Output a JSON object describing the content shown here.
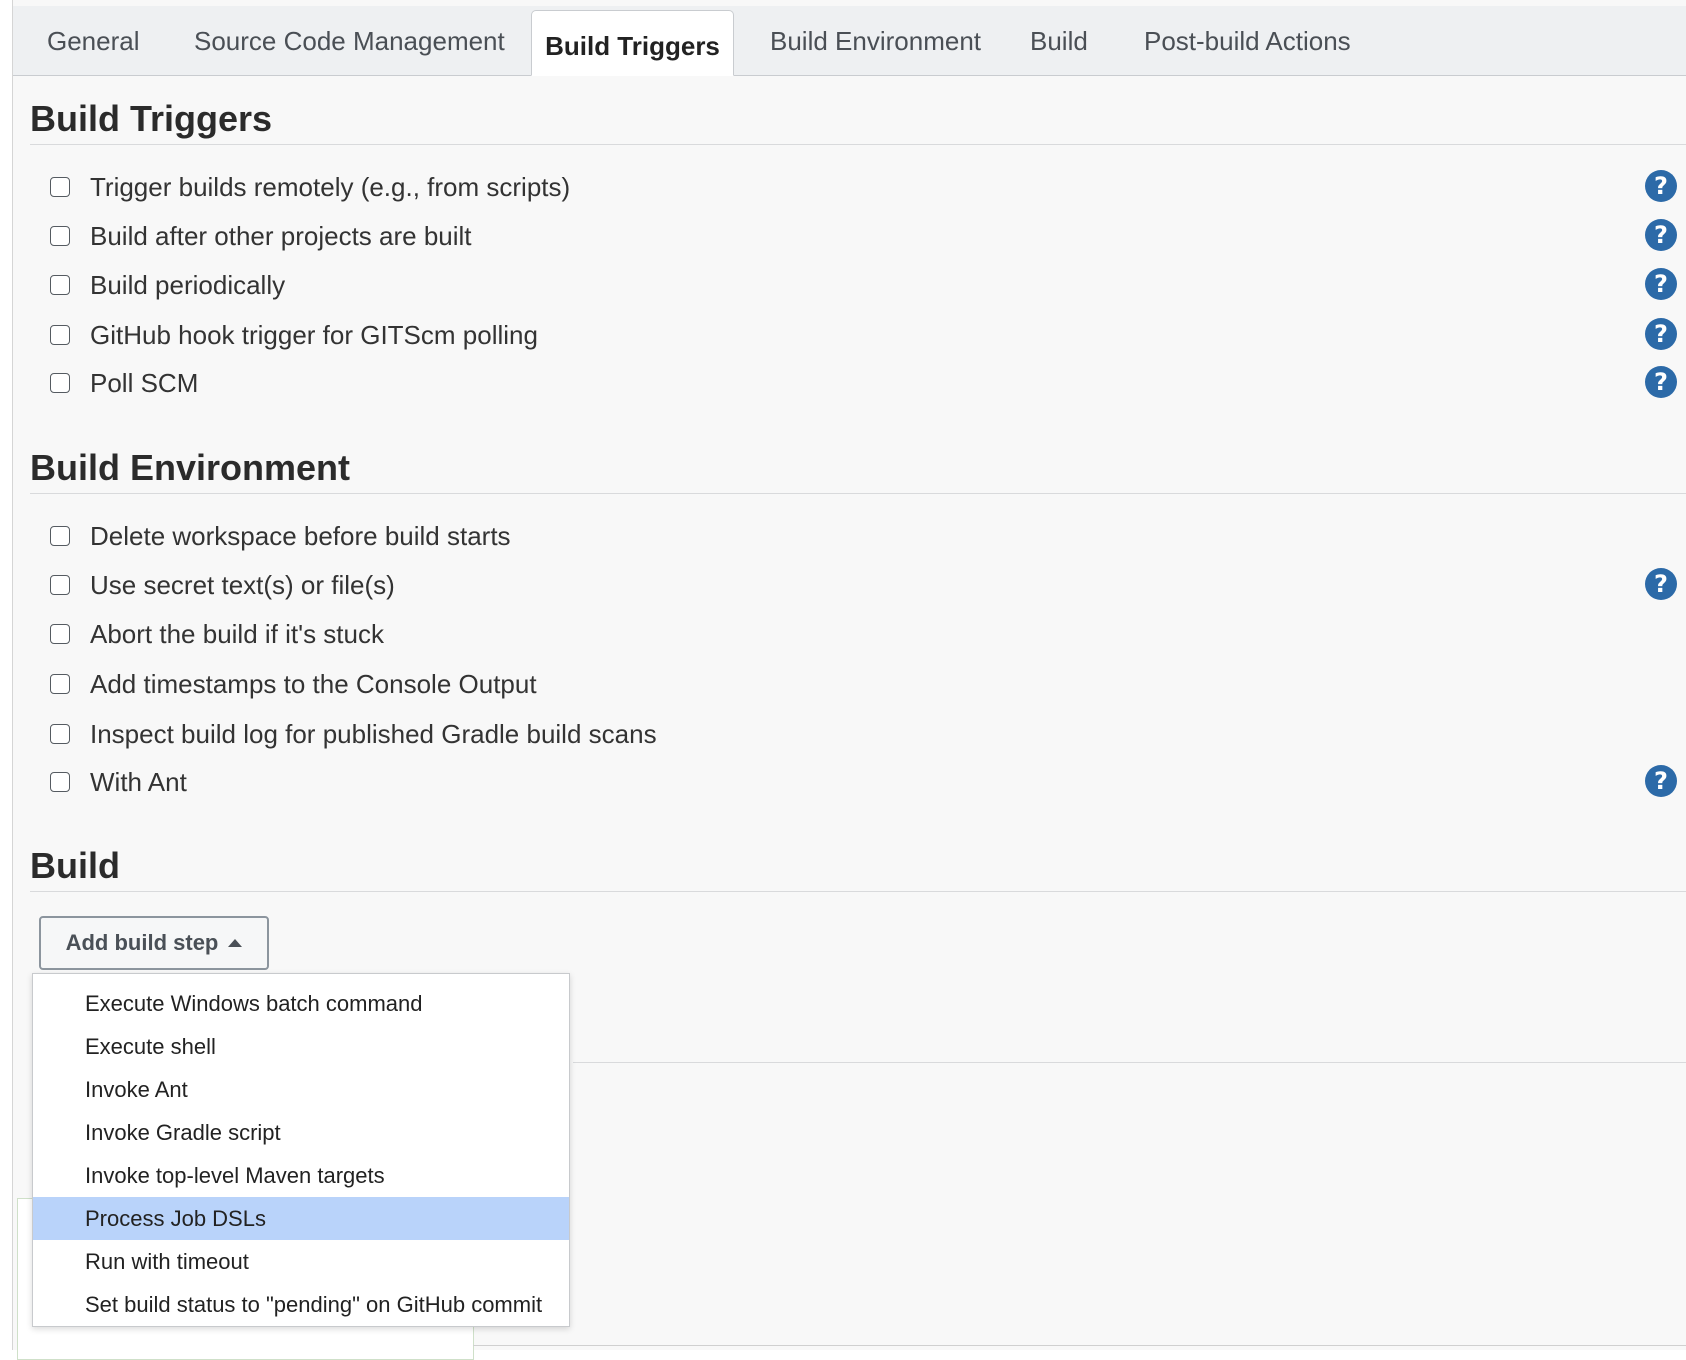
{
  "tabs": [
    {
      "label": "General"
    },
    {
      "label": "Source Code Management"
    },
    {
      "label": "Build Triggers"
    },
    {
      "label": "Build Environment"
    },
    {
      "label": "Build"
    },
    {
      "label": "Post-build Actions"
    }
  ],
  "active_tab": "Build Triggers",
  "build_triggers": {
    "title": "Build Triggers",
    "options": [
      {
        "label": "Trigger builds remotely (e.g., from scripts)",
        "checked": false,
        "help": true
      },
      {
        "label": "Build after other projects are built",
        "checked": false,
        "help": true
      },
      {
        "label": "Build periodically",
        "checked": false,
        "help": true
      },
      {
        "label": "GitHub hook trigger for GITScm polling",
        "checked": false,
        "help": true
      },
      {
        "label": "Poll SCM",
        "checked": false,
        "help": true
      }
    ]
  },
  "build_environment": {
    "title": "Build Environment",
    "options": [
      {
        "label": "Delete workspace before build starts",
        "checked": false,
        "help": false
      },
      {
        "label": "Use secret text(s) or file(s)",
        "checked": false,
        "help": true
      },
      {
        "label": "Abort the build if it's stuck",
        "checked": false,
        "help": false
      },
      {
        "label": "Add timestamps to the Console Output",
        "checked": false,
        "help": false
      },
      {
        "label": "Inspect build log for published Gradle build scans",
        "checked": false,
        "help": false
      },
      {
        "label": "With Ant",
        "checked": false,
        "help": true
      }
    ]
  },
  "build": {
    "title": "Build",
    "add_step_label": "Add build step",
    "menu": {
      "items": [
        {
          "label": "Execute Windows batch command"
        },
        {
          "label": "Execute shell"
        },
        {
          "label": "Invoke Ant"
        },
        {
          "label": "Invoke Gradle script"
        },
        {
          "label": "Invoke top-level Maven targets"
        },
        {
          "label": "Process Job DSLs"
        },
        {
          "label": "Run with timeout"
        },
        {
          "label": "Set build status to \"pending\" on GitHub commit"
        }
      ],
      "highlighted": "Process Job DSLs"
    }
  },
  "help_glyph": "?",
  "colors": {
    "help_icon": "#2c6aa8",
    "menu_highlight": "#b9d3fa",
    "page_bg": "#f8f8f8",
    "tabbar_bg": "#eef0f2"
  }
}
